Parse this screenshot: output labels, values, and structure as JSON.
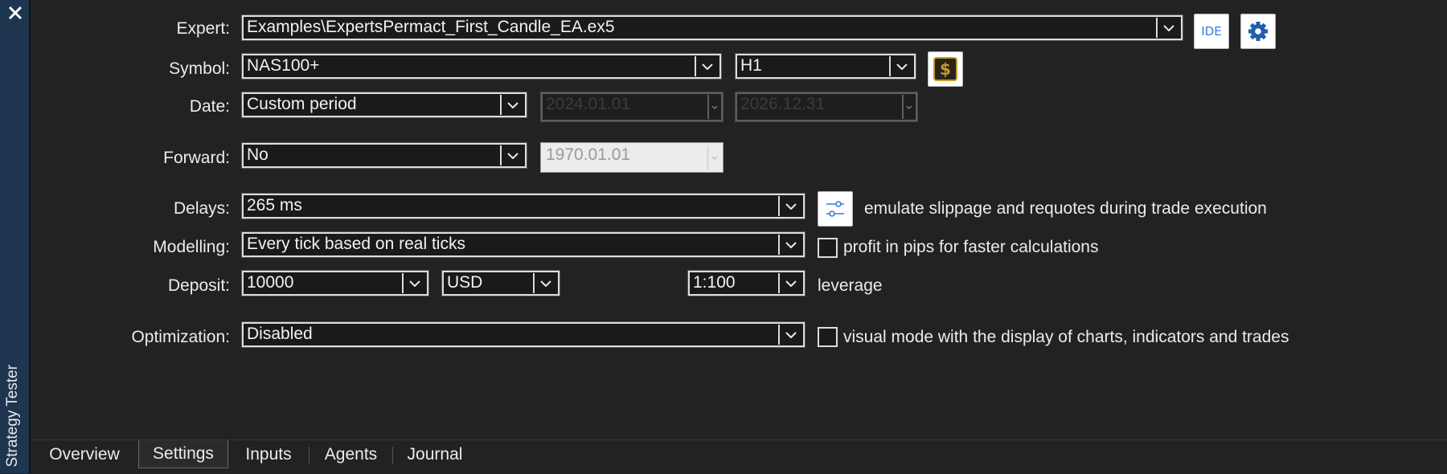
{
  "sidebar": {
    "title": "Strategy Tester",
    "close_icon": "close-icon"
  },
  "labels": {
    "expert": "Expert:",
    "symbol": "Symbol:",
    "date": "Date:",
    "forward": "Forward:",
    "delays": "Delays:",
    "modelling": "Modelling:",
    "deposit": "Deposit:",
    "optimization": "Optimization:"
  },
  "fields": {
    "expert": "Examples\\ExpertsPermact_First_Candle_EA.ex5",
    "symbol": "NAS100+",
    "timeframe": "H1",
    "date_mode": "Custom period",
    "date_from": "2024.01.01",
    "date_to": "2026.12.31",
    "forward": "No",
    "forward_date": "1970.01.01",
    "delays": "265 ms",
    "modelling": "Every tick based on real ticks",
    "deposit": "10000",
    "currency": "USD",
    "leverage": "1:100",
    "optimization": "Disabled"
  },
  "buttons": {
    "ide": "IDE"
  },
  "options": {
    "slippage_text": "emulate slippage and requotes during trade execution",
    "pips_text": "profit in pips for faster calculations",
    "pips_checked": false,
    "leverage_text": "leverage",
    "visual_text": "visual mode with the display of charts, indicators and trades",
    "visual_checked": false
  },
  "tabs": [
    "Overview",
    "Settings",
    "Inputs",
    "Agents",
    "Journal"
  ],
  "active_tab": "Settings",
  "colors": {
    "background": "#222223",
    "sidebar": "#1e3550",
    "ide_text": "#3a7bd5",
    "settings_icon": "#1f5fae",
    "dollar_icon": "#c79a2e"
  }
}
